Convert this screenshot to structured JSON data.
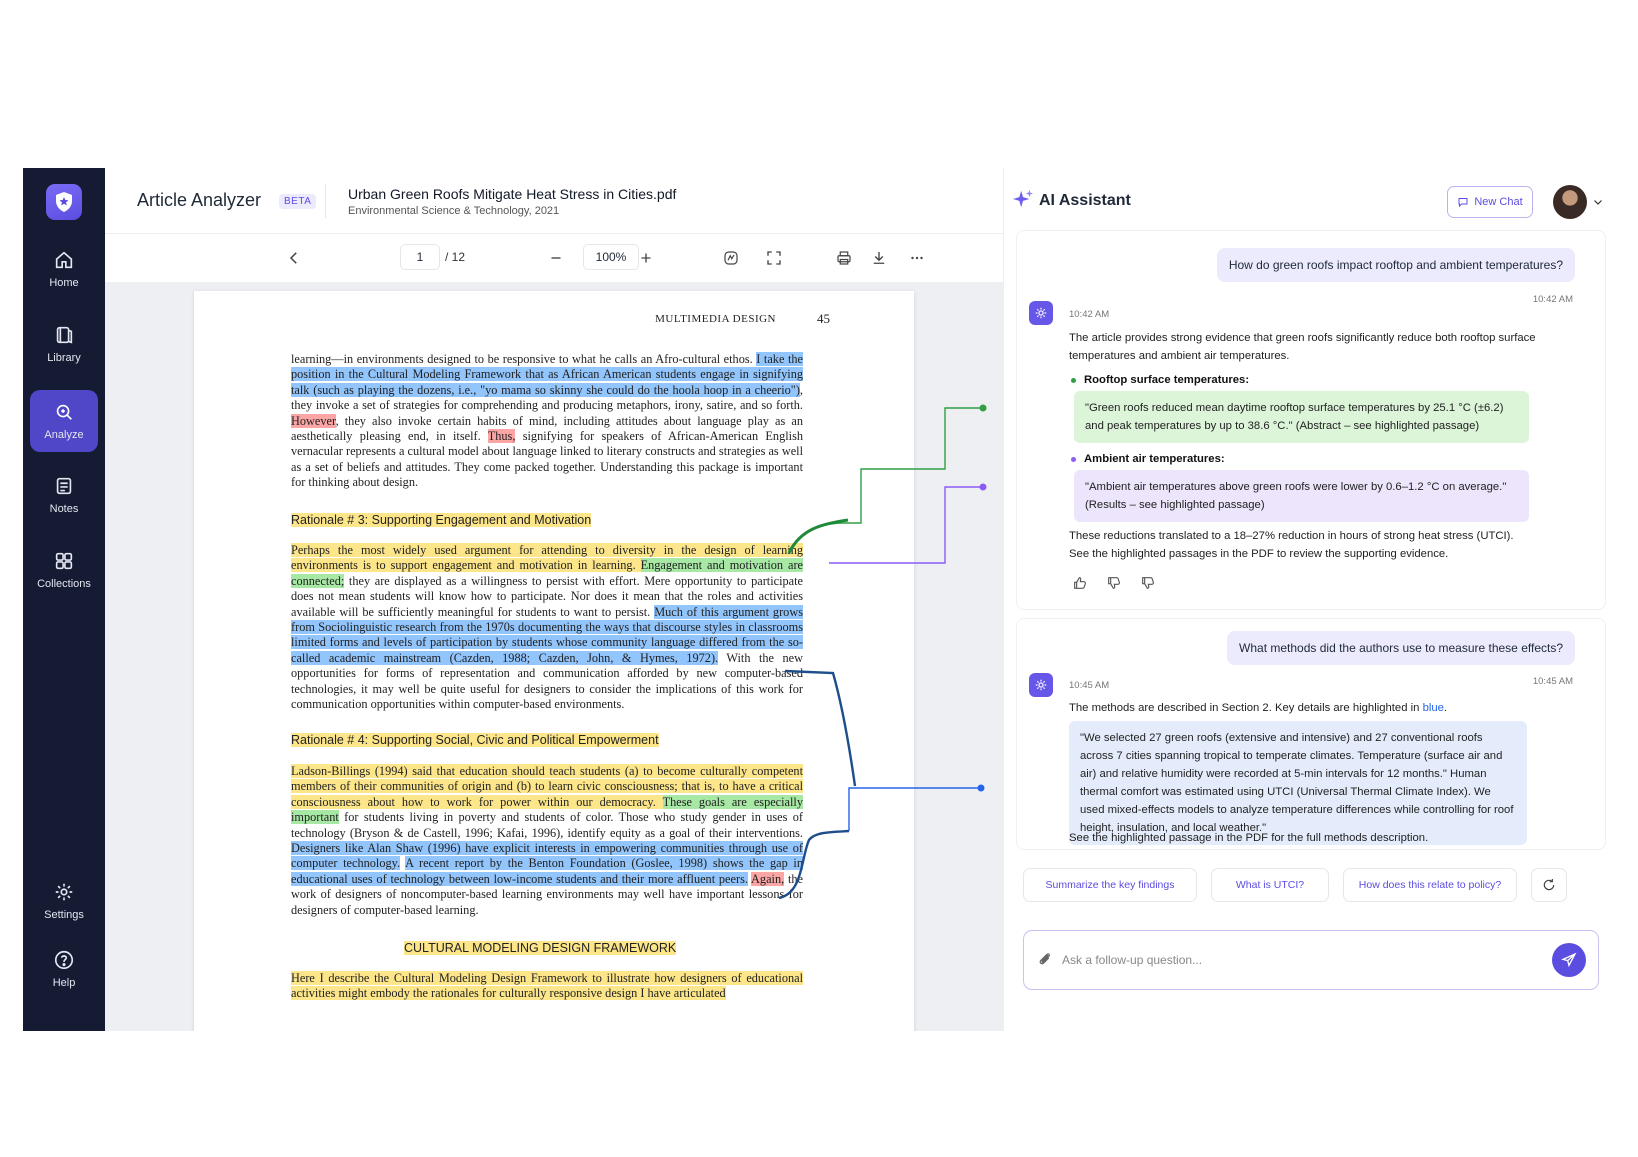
{
  "sidebar": {
    "items": [
      {
        "label": "Home",
        "icon": "home-icon"
      },
      {
        "label": "Library",
        "icon": "library-icon"
      },
      {
        "label": "Analyze",
        "icon": "analyze-icon"
      },
      {
        "label": "Notes",
        "icon": "notes-icon"
      },
      {
        "label": "Collections",
        "icon": "collections-icon"
      },
      {
        "label": "Settings",
        "icon": "gear-icon"
      },
      {
        "label": "Help",
        "icon": "help-icon"
      }
    ],
    "active": "Analyze",
    "bg_color": "#141b33",
    "accent_color": "#4f46c8"
  },
  "header": {
    "app_title": "Article Analyzer",
    "badge": "BETA",
    "file_name": "Urban Green Roofs Mitigate Heat Stress in Cities.pdf",
    "file_subtitle": "Environmental Science & Technology, 2021"
  },
  "toolbar": {
    "page_current": "1",
    "page_total": "/  12",
    "zoom": "100%"
  },
  "document": {
    "running_head": "MULTIMEDIA DESIGN",
    "page_number": "45",
    "p1": {
      "a": "learning—in environments designed to be responsive to what he calls an Afro-cultural ethos. ",
      "b": "I take the position in the Cultural Modeling Framework that as African American students engage in signifying talk (such as playing the dozens, i.e., \"yo mama so skinny she could do the hoola hoop in a cheerio\")",
      "c": ", they invoke a set of strategies for comprehending and producing metaphors, irony, satire, and so forth. ",
      "d": "However",
      "e": ", they also invoke certain habits of mind, including attitudes about language play as an aesthetically pleasing end, in itself. ",
      "f": "Thus,",
      "g": " signifying for speakers of African-American English vernacular represents a cultural model about language linked to literary constructs and strategies as well as a set of beliefs and attitudes. They come packed together. Understanding this package is important for thinking about design."
    },
    "heading1": "Rationale # 3: Supporting Engagement and Motivation",
    "p2": {
      "a": "Perhaps the most widely used argument for attending to diversity in the design of learning environments is to support engagement and motivation in learning. ",
      "b": "Engagement and motivation are connected;",
      "c": " they are displayed as a willingness to persist with effort. Mere opportunity to participate does not mean students will know how to participate. Nor does it mean that the roles and activities available will be sufficiently meaningful for students to want to persist. ",
      "d": "Much of this argument grows from Sociolinguistic research from the 1970s documenting the ways that discourse styles in classrooms limited forms and levels of participation by students whose community language differed from the so-called academic mainstream (Cazden, 1988; Cazden, John, & Hymes, 1972).",
      "e": " With the new opportunities for forms of representation and communication afforded by new computer-based technologies, it may well be quite useful for designers to consider the implications of this work for communication opportunities within computer-based environments."
    },
    "heading2": "Rationale # 4: Supporting Social, Civic and Political Empowerment",
    "p3": {
      "a": "Ladson-Billings (1994) said that education should teach students (a) to become culturally competent members of their communities of origin and (b) to learn civic consciousness; that is, to have a critical consciousness about how to work for power within our democracy. ",
      "b": "These goals are especially important",
      "c": " for students living in poverty and students of color. Those who study gender in uses of technology (Bryson & de Castell, 1996; Kafai, 1996), identify equity as a goal of their interventions. ",
      "d": "Designers like Alan Shaw (1996) have explicit interests in empowering communities through use of computer technology.",
      "e": " ",
      "f": "A recent report by the Benton Foundation (Goslee, 1998) shows the gap in educational uses of technology between low-income students and their more affluent peers.",
      "g": " ",
      "h": "Again,",
      "i": " the work of designers of noncomputer-based learning environments may well have important lessons for designers of computer-based learning."
    },
    "heading3": "CULTURAL MODELING DESIGN FRAMEWORK",
    "p4": "Here I describe the Cultural Modeling Design Framework to illustrate how designers of educational activities might embody the rationales for culturally responsive design I have articulated",
    "highlight_colors": {
      "yellow": "#fde68a",
      "green": "#a7e8a5",
      "blue": "#93c5fd",
      "red": "#fca5a5"
    }
  },
  "assistant": {
    "title": "AI Assistant",
    "new_chat": "New Chat",
    "q1": {
      "text": "How do green roofs impact rooftop and ambient temperatures?",
      "time": "10:42 AM"
    },
    "a1": {
      "time": "10:42 AM",
      "intro": "The article provides strong evidence that green roofs significantly reduce both rooftop surface temperatures and ambient air temperatures.",
      "bullet1": "Rooftop surface temperatures:",
      "quote1": "\"Green roofs reduced mean daytime rooftop surface temperatures by 25.1 °C (±6.2) and peak temperatures by up to 38.6 °C.\" (Abstract – see highlighted passage)",
      "bullet2": "Ambient air temperatures:",
      "quote2": "\"Ambient air temperatures above green roofs were lower by 0.6–1.2 °C on average.\" (Results – see highlighted passage)",
      "outro": "These reductions translated to a 18–27% reduction in hours of strong heat stress (UTCI). See the highlighted passages in the PDF to review the supporting evidence."
    },
    "q2": {
      "text": "What methods did the authors use to measure these effects?",
      "time": "10:45 AM"
    },
    "a2": {
      "time": "10:45 AM",
      "intro": "The methods are described in Section 2. Key details are highlighted in ",
      "intro_link": "blue",
      "intro_end": ".",
      "quote": "\"We selected 27 green roofs (extensive and intensive) and 27 conventional roofs across 7 cities spanning tropical to temperate climates. Temperature (surface air and air) and relative humidity were recorded at 5-min intervals for 12 months.\" Human thermal comfort was estimated using UTCI (Universal Thermal Climate Index). We used mixed-effects models to analyze temperature differences while controlling for roof height, insulation, and local weather.\"",
      "outro": "See the highlighted passage in the PDF for the full methods description."
    },
    "suggestions": [
      "Summarize the key findings",
      "What is UTCI?",
      "How does this relate to policy?"
    ],
    "input_placeholder": "Ask a follow-up question...",
    "accent_color": "#5b4de0"
  }
}
